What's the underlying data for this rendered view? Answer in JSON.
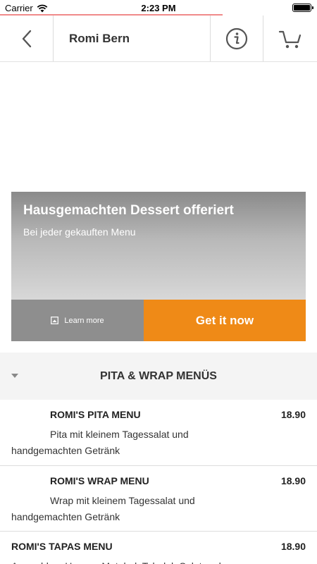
{
  "status": {
    "carrier": "Carrier",
    "time": "2:23 PM"
  },
  "header": {
    "title": "Romi Bern",
    "icons": [
      "back-chevron-icon",
      "info-icon",
      "shopping-cart-icon"
    ]
  },
  "promo": {
    "headline": "Hausgemachten Dessert offeriert",
    "subline": "Bei jeder gekauften Menu",
    "learn_more": "Learn more",
    "cta": "Get it now",
    "cta_color": "#ef8a17"
  },
  "section": {
    "title": "PITA & WRAP MENÜS"
  },
  "items": [
    {
      "name": "ROMI'S PITA MENU",
      "price": "18.90",
      "description": "Pita mit kleinem Tagessalat und handgemachten Getränk"
    },
    {
      "name": "ROMI'S WRAP MENU",
      "price": "18.90",
      "description": "Wrap mit kleinem Tagessalat und handgemachten Getränk"
    },
    {
      "name": "ROMI'S TAPAS MENU",
      "price": "18.90",
      "description": "Auswahl an Humus, Mutabal, Tabuleh Salat und"
    }
  ]
}
